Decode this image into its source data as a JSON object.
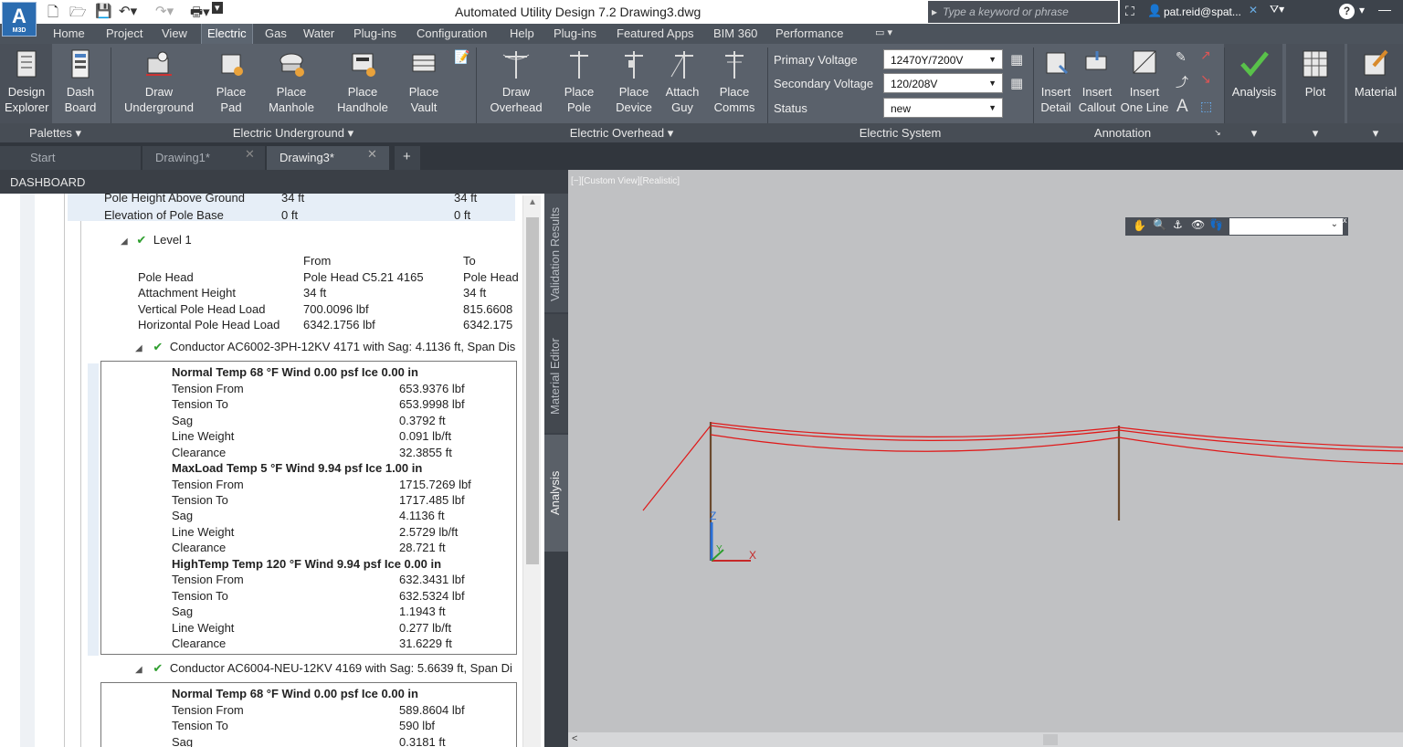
{
  "app": {
    "logo": "A",
    "logo_sub": "M3D",
    "title": "Automated Utility Design 7.2    Drawing3.dwg",
    "search_placeholder": "Type a keyword or phrase",
    "user": "pat.reid@spat...",
    "help": "?"
  },
  "menu": [
    "Home",
    "Project",
    "View",
    "Electric",
    "Gas",
    "Water",
    "Plug-ins",
    "Configuration",
    "Help",
    "Plug-ins",
    "Featured Apps",
    "BIM 360",
    "Performance"
  ],
  "ribbon": {
    "buttons": [
      {
        "l1": "Design",
        "l2": "Explorer"
      },
      {
        "l1": "Dash",
        "l2": "Board"
      },
      {
        "l1": "Draw",
        "l2": "Underground"
      },
      {
        "l1": "Place",
        "l2": "Pad"
      },
      {
        "l1": "Place",
        "l2": "Manhole"
      },
      {
        "l1": "Place",
        "l2": "Handhole"
      },
      {
        "l1": "Place",
        "l2": "Vault"
      },
      {
        "l1": "Draw",
        "l2": "Overhead"
      },
      {
        "l1": "Place",
        "l2": "Pole"
      },
      {
        "l1": "Place",
        "l2": "Device"
      },
      {
        "l1": "Attach",
        "l2": "Guy"
      },
      {
        "l1": "Place",
        "l2": "Comms"
      },
      {
        "l1": "Insert",
        "l2": "Detail"
      },
      {
        "l1": "Insert",
        "l2": "Callout"
      },
      {
        "l1": "Insert",
        "l2": "One Line"
      },
      {
        "l1": "Analysis",
        "l2": ""
      },
      {
        "l1": "Plot",
        "l2": ""
      },
      {
        "l1": "Material",
        "l2": ""
      }
    ],
    "electric_system": {
      "primary_label": "Primary Voltage",
      "primary_value": "12470Y/7200V",
      "secondary_label": "Secondary Voltage",
      "secondary_value": "120/208V",
      "status_label": "Status",
      "status_value": "new"
    },
    "groups": [
      "Palettes",
      "Electric Underground",
      "Electric Overhead",
      "Electric System",
      "Annotation"
    ]
  },
  "tabs": [
    {
      "label": "Start"
    },
    {
      "label": "Drawing1*"
    },
    {
      "label": "Drawing3*"
    }
  ],
  "dashboard": {
    "title": "DASHBOARD",
    "top_rows": [
      {
        "label": "Pole Height Above Ground",
        "from": "34 ft",
        "to": "34 ft"
      },
      {
        "label": "Elevation of Pole Base",
        "from": "0 ft",
        "to": "0 ft"
      }
    ],
    "level": "Level 1",
    "col_from": "From",
    "col_to": "To",
    "level_rows": [
      {
        "label": "Pole Head",
        "from": "Pole Head C5.21 4165",
        "to": "Pole Head"
      },
      {
        "label": "Attachment Height",
        "from": "34 ft",
        "to": "34 ft"
      },
      {
        "label": "Vertical Pole Head Load",
        "from": "700.0096 lbf",
        "to": "815.6608"
      },
      {
        "label": "Horizontal Pole Head Load",
        "from": "6342.1756 lbf",
        "to": "6342.175"
      }
    ],
    "conductor1": "Conductor AC6002-3PH-12KV 4171 with Sag: 4.1136 ft, Span Dis",
    "conductor1_sections": [
      {
        "header": "Normal  Temp  68 °F  Wind  0.00 psf  Ice  0.00 in",
        "rows": [
          {
            "k": "Tension From",
            "v": "653.9376 lbf"
          },
          {
            "k": "Tension To",
            "v": "653.9998 lbf"
          },
          {
            "k": "Sag",
            "v": "0.3792 ft"
          },
          {
            "k": "Line Weight",
            "v": "0.091 lb/ft"
          },
          {
            "k": "Clearance",
            "v": "32.3855 ft"
          }
        ]
      },
      {
        "header": "MaxLoad  Temp  5 °F  Wind  9.94 psf  Ice  1.00 in",
        "rows": [
          {
            "k": "Tension From",
            "v": "1715.7269 lbf"
          },
          {
            "k": "Tension To",
            "v": "1717.485 lbf"
          },
          {
            "k": "Sag",
            "v": "4.1136 ft"
          },
          {
            "k": "Line Weight",
            "v": "2.5729 lb/ft"
          },
          {
            "k": "Clearance",
            "v": "28.721 ft"
          }
        ]
      },
      {
        "header": "HighTemp  Temp  120 °F  Wind  9.94 psf  Ice  0.00 in",
        "rows": [
          {
            "k": "Tension From",
            "v": "632.3431 lbf"
          },
          {
            "k": "Tension To",
            "v": "632.5324 lbf"
          },
          {
            "k": "Sag",
            "v": "1.1943 ft"
          },
          {
            "k": "Line Weight",
            "v": "0.277 lb/ft"
          },
          {
            "k": "Clearance",
            "v": "31.6229 ft"
          }
        ]
      }
    ],
    "conductor2": "Conductor AC6004-NEU-12KV 4169 with Sag: 5.6639 ft, Span Di",
    "conductor2_section": {
      "header": "Normal  Temp  68 °F  Wind  0.00 psf  Ice  0.00 in",
      "rows": [
        {
          "k": "Tension From",
          "v": "589.8604 lbf"
        },
        {
          "k": "Tension To",
          "v": "590 lbf"
        },
        {
          "k": "Sag",
          "v": "0.3181 ft"
        }
      ]
    }
  },
  "side_tabs": [
    "Validation Results",
    "Material Editor",
    "Analysis"
  ],
  "viewport": {
    "label": "[−][Custom View][Realistic]",
    "axis_x": "X",
    "axis_y": "Y",
    "axis_z": "Z"
  }
}
